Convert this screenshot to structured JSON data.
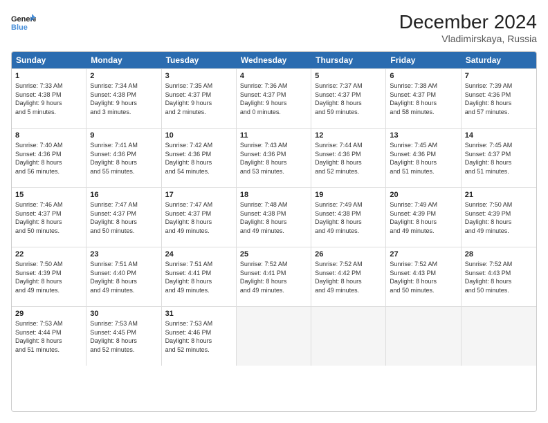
{
  "header": {
    "logo_line1": "General",
    "logo_line2": "Blue",
    "title": "December 2024",
    "subtitle": "Vladimirskaya, Russia"
  },
  "weekdays": [
    "Sunday",
    "Monday",
    "Tuesday",
    "Wednesday",
    "Thursday",
    "Friday",
    "Saturday"
  ],
  "weeks": [
    [
      {
        "day": "1",
        "sunrise": "7:33 AM",
        "sunset": "4:38 PM",
        "daylight": "9 hours and 5 minutes."
      },
      {
        "day": "2",
        "sunrise": "7:34 AM",
        "sunset": "4:38 PM",
        "daylight": "9 hours and 3 minutes."
      },
      {
        "day": "3",
        "sunrise": "7:35 AM",
        "sunset": "4:37 PM",
        "daylight": "9 hours and 2 minutes."
      },
      {
        "day": "4",
        "sunrise": "7:36 AM",
        "sunset": "4:37 PM",
        "daylight": "9 hours and 0 minutes."
      },
      {
        "day": "5",
        "sunrise": "7:37 AM",
        "sunset": "4:37 PM",
        "daylight": "8 hours and 59 minutes."
      },
      {
        "day": "6",
        "sunrise": "7:38 AM",
        "sunset": "4:37 PM",
        "daylight": "8 hours and 58 minutes."
      },
      {
        "day": "7",
        "sunrise": "7:39 AM",
        "sunset": "4:36 PM",
        "daylight": "8 hours and 57 minutes."
      }
    ],
    [
      {
        "day": "8",
        "sunrise": "7:40 AM",
        "sunset": "4:36 PM",
        "daylight": "8 hours and 56 minutes."
      },
      {
        "day": "9",
        "sunrise": "7:41 AM",
        "sunset": "4:36 PM",
        "daylight": "8 hours and 55 minutes."
      },
      {
        "day": "10",
        "sunrise": "7:42 AM",
        "sunset": "4:36 PM",
        "daylight": "8 hours and 54 minutes."
      },
      {
        "day": "11",
        "sunrise": "7:43 AM",
        "sunset": "4:36 PM",
        "daylight": "8 hours and 53 minutes."
      },
      {
        "day": "12",
        "sunrise": "7:44 AM",
        "sunset": "4:36 PM",
        "daylight": "8 hours and 52 minutes."
      },
      {
        "day": "13",
        "sunrise": "7:45 AM",
        "sunset": "4:36 PM",
        "daylight": "8 hours and 51 minutes."
      },
      {
        "day": "14",
        "sunrise": "7:45 AM",
        "sunset": "4:37 PM",
        "daylight": "8 hours and 51 minutes."
      }
    ],
    [
      {
        "day": "15",
        "sunrise": "7:46 AM",
        "sunset": "4:37 PM",
        "daylight": "8 hours and 50 minutes."
      },
      {
        "day": "16",
        "sunrise": "7:47 AM",
        "sunset": "4:37 PM",
        "daylight": "8 hours and 50 minutes."
      },
      {
        "day": "17",
        "sunrise": "7:47 AM",
        "sunset": "4:37 PM",
        "daylight": "8 hours and 49 minutes."
      },
      {
        "day": "18",
        "sunrise": "7:48 AM",
        "sunset": "4:38 PM",
        "daylight": "8 hours and 49 minutes."
      },
      {
        "day": "19",
        "sunrise": "7:49 AM",
        "sunset": "4:38 PM",
        "daylight": "8 hours and 49 minutes."
      },
      {
        "day": "20",
        "sunrise": "7:49 AM",
        "sunset": "4:39 PM",
        "daylight": "8 hours and 49 minutes."
      },
      {
        "day": "21",
        "sunrise": "7:50 AM",
        "sunset": "4:39 PM",
        "daylight": "8 hours and 49 minutes."
      }
    ],
    [
      {
        "day": "22",
        "sunrise": "7:50 AM",
        "sunset": "4:39 PM",
        "daylight": "8 hours and 49 minutes."
      },
      {
        "day": "23",
        "sunrise": "7:51 AM",
        "sunset": "4:40 PM",
        "daylight": "8 hours and 49 minutes."
      },
      {
        "day": "24",
        "sunrise": "7:51 AM",
        "sunset": "4:41 PM",
        "daylight": "8 hours and 49 minutes."
      },
      {
        "day": "25",
        "sunrise": "7:52 AM",
        "sunset": "4:41 PM",
        "daylight": "8 hours and 49 minutes."
      },
      {
        "day": "26",
        "sunrise": "7:52 AM",
        "sunset": "4:42 PM",
        "daylight": "8 hours and 49 minutes."
      },
      {
        "day": "27",
        "sunrise": "7:52 AM",
        "sunset": "4:43 PM",
        "daylight": "8 hours and 50 minutes."
      },
      {
        "day": "28",
        "sunrise": "7:52 AM",
        "sunset": "4:43 PM",
        "daylight": "8 hours and 50 minutes."
      }
    ],
    [
      {
        "day": "29",
        "sunrise": "7:53 AM",
        "sunset": "4:44 PM",
        "daylight": "8 hours and 51 minutes."
      },
      {
        "day": "30",
        "sunrise": "7:53 AM",
        "sunset": "4:45 PM",
        "daylight": "8 hours and 52 minutes."
      },
      {
        "day": "31",
        "sunrise": "7:53 AM",
        "sunset": "4:46 PM",
        "daylight": "8 hours and 52 minutes."
      },
      null,
      null,
      null,
      null
    ]
  ],
  "colors": {
    "header_bg": "#2b6cb0",
    "header_text": "#ffffff",
    "border": "#cccccc",
    "empty_bg": "#f5f5f5"
  }
}
